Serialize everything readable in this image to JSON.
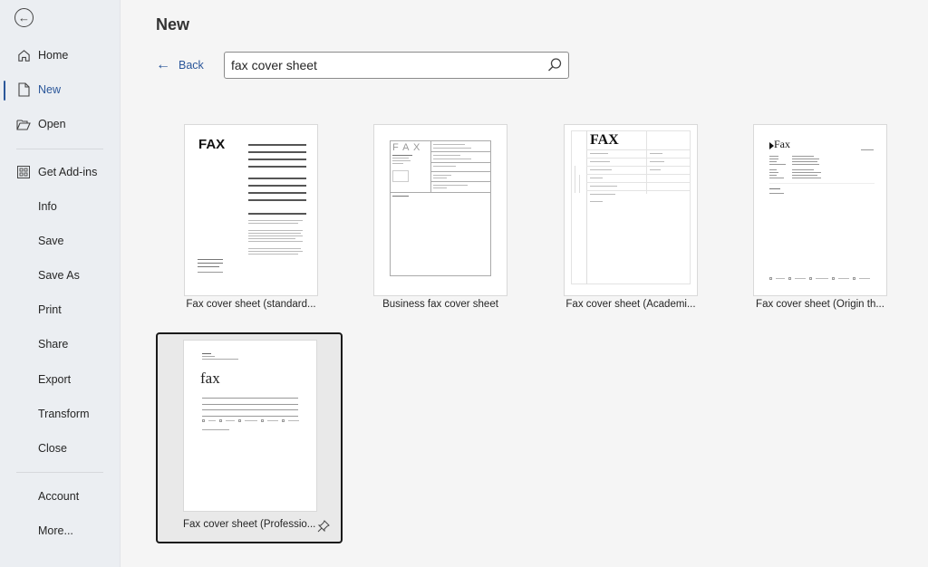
{
  "sidebar": {
    "back_icon": "back-circle-arrow-icon",
    "items": [
      {
        "label": "Home",
        "icon": "home-icon"
      },
      {
        "label": "New",
        "icon": "new-document-icon",
        "active": true
      },
      {
        "label": "Open",
        "icon": "folder-open-icon"
      },
      {
        "label": "Get Add-ins",
        "icon": "add-ins-grid-icon"
      },
      {
        "label": "Info"
      },
      {
        "label": "Save"
      },
      {
        "label": "Save As"
      },
      {
        "label": "Print"
      },
      {
        "label": "Share"
      },
      {
        "label": "Export"
      },
      {
        "label": "Transform"
      },
      {
        "label": "Close"
      },
      {
        "label": "Account"
      },
      {
        "label": "More..."
      }
    ]
  },
  "main": {
    "title": "New",
    "back_label": "Back",
    "search": {
      "value": "fax cover sheet",
      "icon": "search-icon"
    },
    "templates": [
      {
        "label": "Fax cover sheet (standard...",
        "thumb_title": "FAX"
      },
      {
        "label": "Business fax cover sheet",
        "thumb_title": "F A X"
      },
      {
        "label": "Fax cover sheet (Academi...",
        "thumb_title": "FAX"
      },
      {
        "label": "Fax cover sheet (Origin th...",
        "thumb_title": "Fax"
      },
      {
        "label": "Fax cover sheet (Professio...",
        "thumb_title": "fax",
        "selected": true,
        "pin_icon": "pin-icon"
      }
    ]
  }
}
